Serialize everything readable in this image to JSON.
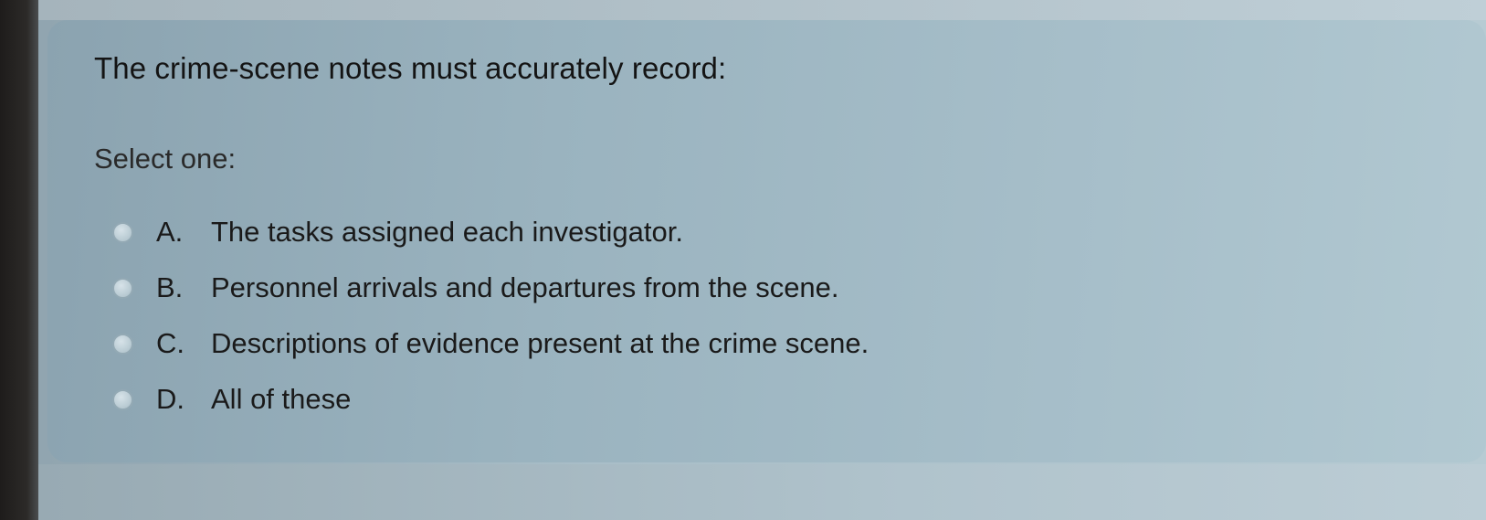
{
  "question": {
    "text": "The crime-scene notes must accurately record:",
    "prompt": "Select one:"
  },
  "options": [
    {
      "letter": "A.",
      "text": "The tasks assigned each investigator."
    },
    {
      "letter": "B.",
      "text": "Personnel arrivals and departures from the scene."
    },
    {
      "letter": "C.",
      "text": "Descriptions of evidence present at the crime scene."
    },
    {
      "letter": "D.",
      "text": "All of these"
    }
  ]
}
